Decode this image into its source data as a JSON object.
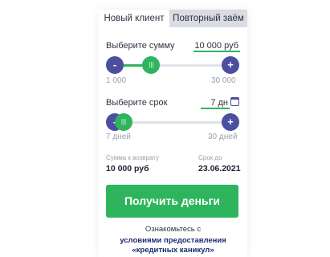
{
  "tabs": {
    "new_client": "Новый клиент",
    "repeat_loan": "Повторный заём"
  },
  "amount": {
    "label": "Выберите сумму",
    "value": "10 000",
    "unit": "руб",
    "min_label": "1 000",
    "max_label": "30 000",
    "minus": "-",
    "plus": "+",
    "thumb_glyph": "|||",
    "level": 0.31
  },
  "term": {
    "label": "Выберите срок",
    "value": "7",
    "unit": "дн",
    "min_label": "7 дней",
    "max_label": "30 дней",
    "minus": "-",
    "plus": "+",
    "thumb_glyph": "|||",
    "level": 0.0,
    "calendar_icon": "calendar-icon"
  },
  "summary": {
    "return_label": "Сумма к возврату",
    "return_value": "10 000 руб",
    "due_label": "Срок до",
    "due_value": "23.06.2021"
  },
  "cta": {
    "label": "Получить деньги"
  },
  "footer": {
    "note": "Ознакомьтесь с",
    "link_line1": "условиями предоставления",
    "link_line2": "«кредитных каникул»"
  },
  "colors": {
    "accent_green": "#2fb45e",
    "button_purple": "#4b4fa0",
    "link_navy": "#1b2a70"
  }
}
